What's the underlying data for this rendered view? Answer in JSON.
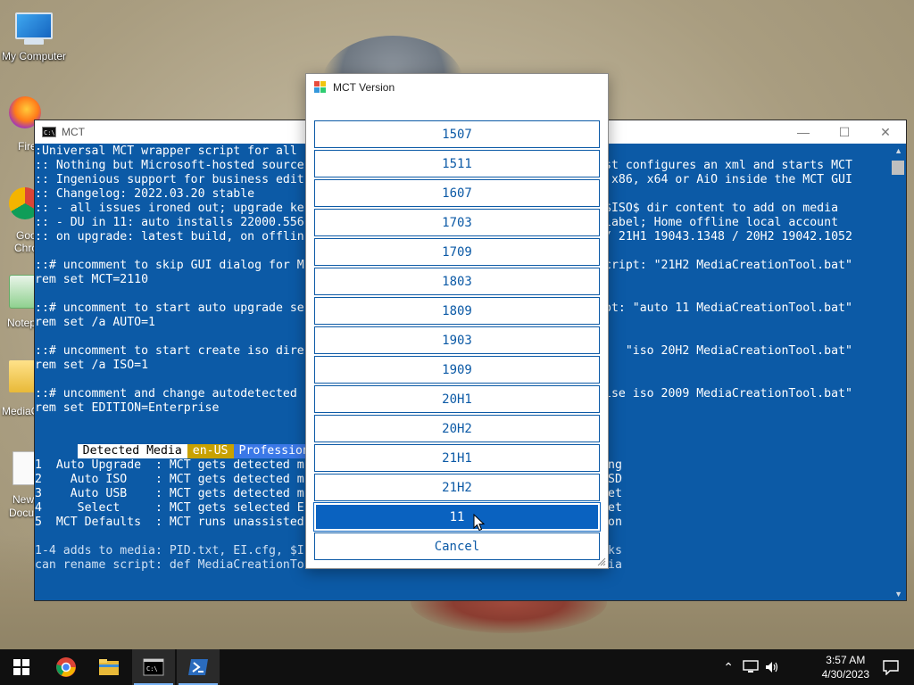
{
  "desktop": {
    "icons": [
      {
        "label": "My Computer",
        "icon": "computer-icon"
      }
    ],
    "partial_labels": [
      {
        "label": "Fire",
        "icon": "firefox-icon"
      },
      {
        "label": "Goo",
        "icon": "chrome-icon"
      },
      {
        "label": "Chro",
        "icon": "chrome-icon"
      },
      {
        "label": "Notep",
        "icon": "notepad-icon"
      },
      {
        "label": "MediaC",
        "icon": "folder-icon"
      },
      {
        "label": "New",
        "icon": "document-icon"
      },
      {
        "label": "Docu",
        "icon": "document-icon"
      }
    ]
  },
  "console": {
    "title": "MCT",
    "lines": [
      ":Universal MCT wrapper script for all",
      ":: Nothing but Microsoft-hosted source",
      ":: Ingenious support for business edit",
      ":: Changelog: 2022.03.20 stable",
      ":: - all issues ironed out; upgrade ke",
      ":: - DU in 11: auto installs 22000.556",
      ":: on upgrade: latest build, on offlin",
      "",
      "::# uncomment to skip GUI dialog for M",
      "rem set MCT=2110",
      "",
      "::# uncomment to start auto upgrade se",
      "rem set /a AUTO=1",
      "",
      "::# uncomment to start create iso dire",
      "rem set /a ISO=1",
      "",
      "::# uncomment and change autodetected",
      "rem set EDITION=Enterprise"
    ],
    "right_lines": [
      "",
      "st configures an xml and starts MCT",
      " x86, x64 or AiO inside the MCT GUI",
      "",
      "$ISO$ dir content to add on media",
      "label; Home offline local account",
      "/ 21H1 19043.1348 / 20H2 19042.1052",
      "",
      "cript: \"21H2 MediaCreationTool.bat\"",
      "",
      "",
      "pt: \"auto 11 MediaCreationTool.bat\"",
      "",
      "",
      "   \"iso 20H2 MediaCreationTool.bat\"",
      "",
      "",
      "ise iso 2009 MediaCreationTool.bat\"",
      ""
    ],
    "highlights": [
      {
        "text": "Detected Media",
        "bg": "#ffffff",
        "fg": "#000000"
      },
      {
        "text": "en-US",
        "bg": "#c9a100",
        "fg": "#ffffff"
      },
      {
        "text": "Professional",
        "bg": "#3b78e7",
        "fg": "#ffffff"
      }
    ],
    "menu_lines": [
      "1  Auto Upgrade  : MCT gets detected m",
      "2    Auto ISO    : MCT gets detected m",
      "3    Auto USB    : MCT gets detected m",
      "4     Select     : MCT gets selected E",
      "5  MCT Defaults  : MCT runs unassisted"
    ],
    "menu_right": [
      "ng",
      "SD",
      "et",
      "et",
      "on"
    ],
    "footer_lines": [
      "1-4 adds to media: PID.txt, EI.cfg, $I",
      "can rename script: def MediaCreationTo"
    ],
    "footer_right": [
      "ks",
      "ia"
    ],
    "colors": {
      "background": "#0c5aa6",
      "text": "#ffffff",
      "footer_text": "#cfe0f3"
    }
  },
  "dialog": {
    "title": "MCT Version",
    "versions": [
      "1507",
      "1511",
      "1607",
      "1703",
      "1709",
      "1803",
      "1809",
      "1903",
      "1909",
      "20H1",
      "20H2",
      "21H1",
      "21H2",
      "11"
    ],
    "selected": "11",
    "cancel_label": "Cancel"
  },
  "taskbar": {
    "items": [
      "start-icon",
      "chrome-icon",
      "file-explorer-icon",
      "terminal-icon",
      "powershell-icon"
    ],
    "time": "3:57 AM",
    "date": "4/30/2023",
    "tray_icons": [
      "chevron-up-icon",
      "network-icon",
      "volume-icon",
      "notification-icon"
    ]
  }
}
